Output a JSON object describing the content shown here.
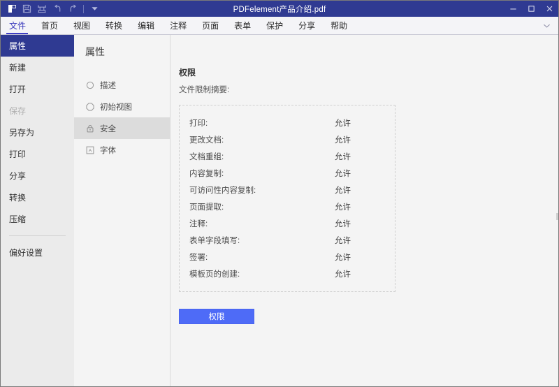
{
  "titlebar": {
    "document_title": "PDFelement产品介绍.pdf",
    "quick_access": [
      {
        "name": "app-logo-icon",
        "label": "PDFelement"
      },
      {
        "name": "save-icon",
        "label": "保存"
      },
      {
        "name": "stamp-icon",
        "label": "印章"
      },
      {
        "name": "undo-icon",
        "label": "撤销"
      },
      {
        "name": "redo-icon",
        "label": "重做"
      },
      {
        "name": "customize-dropdown-icon",
        "label": "自定义快速访问工具栏"
      }
    ],
    "window_controls": [
      {
        "name": "minimize-button",
        "glyph": "—"
      },
      {
        "name": "maximize-button",
        "glyph": "▢"
      },
      {
        "name": "close-button",
        "glyph": "✕"
      }
    ]
  },
  "menubar": {
    "items": [
      {
        "label": "文件",
        "active": true
      },
      {
        "label": "首页",
        "active": false
      },
      {
        "label": "视图",
        "active": false
      },
      {
        "label": "转换",
        "active": false
      },
      {
        "label": "编辑",
        "active": false
      },
      {
        "label": "注释",
        "active": false
      },
      {
        "label": "页面",
        "active": false
      },
      {
        "label": "表单",
        "active": false
      },
      {
        "label": "保护",
        "active": false
      },
      {
        "label": "分享",
        "active": false
      },
      {
        "label": "帮助",
        "active": false
      }
    ],
    "expand_icon": "chevron-down-icon"
  },
  "sidebar": {
    "items": [
      {
        "label": "属性",
        "state": "selected"
      },
      {
        "label": "新建",
        "state": "normal"
      },
      {
        "label": "打开",
        "state": "normal"
      },
      {
        "label": "保存",
        "state": "disabled"
      },
      {
        "label": "另存为",
        "state": "normal"
      },
      {
        "label": "打印",
        "state": "normal"
      },
      {
        "label": "分享",
        "state": "normal"
      },
      {
        "label": "转换",
        "state": "normal"
      },
      {
        "label": "压缩",
        "state": "normal"
      }
    ],
    "footer_items": [
      {
        "label": "偏好设置",
        "state": "normal"
      }
    ]
  },
  "midpanel": {
    "title": "属性",
    "items": [
      {
        "label": "描述",
        "icon": "circle-info-icon",
        "selected": false
      },
      {
        "label": "初始视图",
        "icon": "octagon-icon",
        "selected": false
      },
      {
        "label": "安全",
        "icon": "lock-icon",
        "selected": true
      },
      {
        "label": "字体",
        "icon": "font-a-icon",
        "selected": false
      }
    ]
  },
  "content": {
    "section_title": "权限",
    "section_subtitle": "文件限制摘要:",
    "permissions": [
      {
        "label": "打印:",
        "value": "允许"
      },
      {
        "label": "更改文档:",
        "value": "允许"
      },
      {
        "label": "文档重组:",
        "value": "允许"
      },
      {
        "label": "内容复制:",
        "value": "允许"
      },
      {
        "label": "可访问性内容复制:",
        "value": "允许"
      },
      {
        "label": "页面提取:",
        "value": "允许"
      },
      {
        "label": "注释:",
        "value": "允许"
      },
      {
        "label": "表单字段填写:",
        "value": "允许"
      },
      {
        "label": "签署:",
        "value": "允许"
      },
      {
        "label": "模板页的创建:",
        "value": "允许"
      }
    ],
    "button_label": "权限"
  },
  "colors": {
    "titlebar_bg": "#2f3a92",
    "accent_button": "#4e6bf7",
    "sidebar_bg": "#ebebeb",
    "panel_bg": "#f4f4f4",
    "selected_item_bg": "#dcdcdc"
  }
}
